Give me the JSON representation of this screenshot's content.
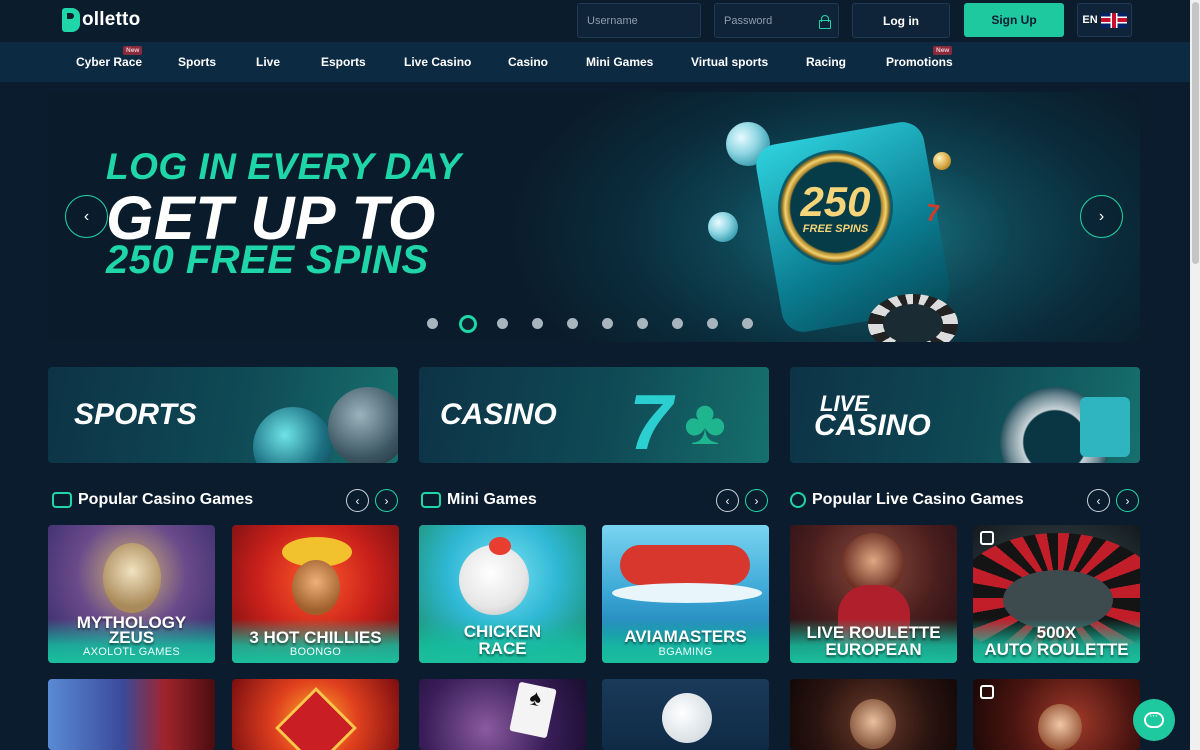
{
  "header": {
    "logo_text": "olletto",
    "username_placeholder": "Username",
    "password_placeholder": "Password",
    "login_label": "Log in",
    "signup_label": "Sign Up",
    "language": "EN"
  },
  "nav": {
    "items": [
      {
        "label": "Cyber Race",
        "badge": "New"
      },
      {
        "label": "Sports",
        "badge": ""
      },
      {
        "label": "Live",
        "badge": ""
      },
      {
        "label": "Esports",
        "badge": ""
      },
      {
        "label": "Live Casino",
        "badge": ""
      },
      {
        "label": "Casino",
        "badge": ""
      },
      {
        "label": "Mini Games",
        "badge": ""
      },
      {
        "label": "Virtual sports",
        "badge": ""
      },
      {
        "label": "Racing",
        "badge": ""
      },
      {
        "label": "Promotions",
        "badge": "New"
      }
    ]
  },
  "banner": {
    "line1": "LOG IN EVERY DAY",
    "line2": "GET UP TO",
    "line3": "250 FREE SPINS",
    "machine_number": "250",
    "machine_caption": "FREE SPINS",
    "slide_count": 10,
    "active_slide": 2
  },
  "categories": [
    {
      "label": "SPORTS"
    },
    {
      "label": "CASINO"
    },
    {
      "label_top": "LIVE",
      "label_bottom": "CASINO"
    }
  ],
  "sections": [
    {
      "title": "Popular Casino Games",
      "icon": "slot-machine-icon",
      "games": [
        {
          "name_top": "MYTHOLOGY",
          "name_bottom": "ZEUS",
          "provider": "AXOLOTL GAMES"
        },
        {
          "name_top": "",
          "name_bottom": "3 HOT CHILLIES",
          "provider": "BOONGO"
        }
      ]
    },
    {
      "title": "Mini Games",
      "icon": "gamepad-icon",
      "games": [
        {
          "name_top": "CHICKEN",
          "name_bottom": "RACE",
          "provider": ""
        },
        {
          "name_top": "",
          "name_bottom": "AVIAMASTERS",
          "provider": "BGAMING"
        }
      ]
    },
    {
      "title": "Popular Live Casino Games",
      "icon": "roulette-icon",
      "games": [
        {
          "name_top": "LIVE ROULETTE",
          "name_bottom": "EUROPEAN",
          "provider": ""
        },
        {
          "name_top": "500X",
          "name_bottom": "AUTO ROULETTE",
          "provider": ""
        }
      ]
    }
  ],
  "colors": {
    "accent": "#1fd6a8",
    "background": "#0a1c2d",
    "nav": "#0d2a43"
  }
}
